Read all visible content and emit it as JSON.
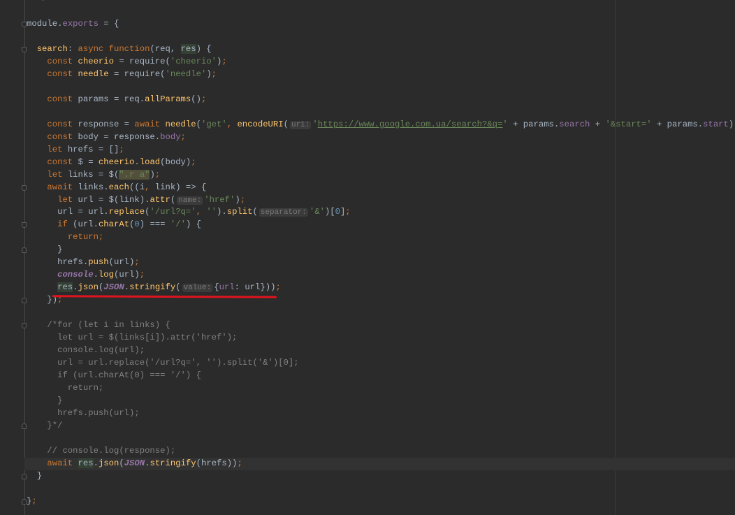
{
  "editor": {
    "theme_colors": {
      "background": "#2b2b2b",
      "keyword": "#cc7832",
      "string": "#6a8759",
      "function": "#ffc66d",
      "property": "#9876aa",
      "annotation": "#e0141e"
    },
    "current_line": 37,
    "lines": [
      [
        [
          "cm",
          "  */"
        ]
      ],
      [],
      [
        [
          "plain",
          "module."
        ],
        [
          "prop",
          "exports"
        ],
        [
          "plain",
          " = {"
        ]
      ],
      [],
      [
        [
          "plain",
          "  "
        ],
        [
          "fn",
          "search"
        ],
        [
          "plain",
          ": "
        ],
        [
          "kw",
          "async function"
        ],
        [
          "plain",
          "(req, "
        ],
        [
          "hl",
          "res"
        ],
        [
          "plain",
          ") {"
        ]
      ],
      [
        [
          "plain",
          "    "
        ],
        [
          "kw",
          "const "
        ],
        [
          "fn",
          "cheerio"
        ],
        [
          "plain",
          " = require("
        ],
        [
          "str",
          "'cheerio'"
        ],
        [
          "plain",
          ")"
        ],
        [
          "kw",
          ";"
        ]
      ],
      [
        [
          "plain",
          "    "
        ],
        [
          "kw",
          "const "
        ],
        [
          "fn",
          "needle"
        ],
        [
          "plain",
          " = require("
        ],
        [
          "str",
          "'needle'"
        ],
        [
          "plain",
          ")"
        ],
        [
          "kw",
          ";"
        ]
      ],
      [],
      [
        [
          "plain",
          "    "
        ],
        [
          "kw",
          "const "
        ],
        [
          "plain",
          "params = req."
        ],
        [
          "fn",
          "allParams"
        ],
        [
          "plain",
          "()"
        ],
        [
          "kw",
          ";"
        ]
      ],
      [],
      [
        [
          "plain",
          "    "
        ],
        [
          "kw",
          "const "
        ],
        [
          "plain",
          "response = "
        ],
        [
          "kw",
          "await "
        ],
        [
          "fn",
          "needle"
        ],
        [
          "plain",
          "("
        ],
        [
          "str",
          "'get'"
        ],
        [
          "kw",
          ", "
        ],
        [
          "fn",
          "encodeURI"
        ],
        [
          "plain",
          "("
        ],
        [
          "hint",
          "uri:"
        ],
        [
          "str",
          "'"
        ],
        [
          "url",
          "https://www.google.com.ua/search?&q="
        ],
        [
          "str",
          "'"
        ],
        [
          "plain",
          " + params."
        ],
        [
          "prop",
          "search"
        ],
        [
          "plain",
          " + "
        ],
        [
          "str",
          "'&start='"
        ],
        [
          "plain",
          " + params."
        ],
        [
          "prop",
          "start"
        ],
        [
          "plain",
          "))"
        ],
        [
          "kw",
          ";"
        ]
      ],
      [
        [
          "plain",
          "    "
        ],
        [
          "kw",
          "const "
        ],
        [
          "plain",
          "body = response."
        ],
        [
          "prop",
          "body"
        ],
        [
          "kw",
          ";"
        ]
      ],
      [
        [
          "plain",
          "    "
        ],
        [
          "kw",
          "let "
        ],
        [
          "plain",
          "hrefs = []"
        ],
        [
          "kw",
          ";"
        ]
      ],
      [
        [
          "plain",
          "    "
        ],
        [
          "kw",
          "const "
        ],
        [
          "plain",
          "$ = "
        ],
        [
          "fn",
          "cheerio"
        ],
        [
          "plain",
          "."
        ],
        [
          "fn",
          "load"
        ],
        [
          "plain",
          "(body)"
        ],
        [
          "kw",
          ";"
        ]
      ],
      [
        [
          "plain",
          "    "
        ],
        [
          "kw",
          "let "
        ],
        [
          "plain",
          "links = $("
        ],
        [
          "sel",
          "\".r a\""
        ],
        [
          "plain",
          ")"
        ],
        [
          "kw",
          ";"
        ]
      ],
      [
        [
          "plain",
          "    "
        ],
        [
          "kw",
          "await "
        ],
        [
          "plain",
          "links."
        ],
        [
          "fn",
          "each"
        ],
        [
          "plain",
          "((i"
        ],
        [
          "kw",
          ", "
        ],
        [
          "plain",
          "link) => {"
        ]
      ],
      [
        [
          "plain",
          "      "
        ],
        [
          "kw",
          "let "
        ],
        [
          "plain",
          "url = $(link)."
        ],
        [
          "fn",
          "attr"
        ],
        [
          "plain",
          "("
        ],
        [
          "hint",
          "name:"
        ],
        [
          "str",
          "'href'"
        ],
        [
          "plain",
          ")"
        ],
        [
          "kw",
          ";"
        ]
      ],
      [
        [
          "plain",
          "      url = url."
        ],
        [
          "fn",
          "replace"
        ],
        [
          "plain",
          "("
        ],
        [
          "str",
          "'/url?q='"
        ],
        [
          "kw",
          ", "
        ],
        [
          "str",
          "''"
        ],
        [
          "plain",
          ")."
        ],
        [
          "fn",
          "split"
        ],
        [
          "plain",
          "("
        ],
        [
          "hint",
          "separator:"
        ],
        [
          "str",
          "'&'"
        ],
        [
          "plain",
          ")["
        ],
        [
          "num",
          "0"
        ],
        [
          "plain",
          "]"
        ],
        [
          "kw",
          ";"
        ]
      ],
      [
        [
          "plain",
          "      "
        ],
        [
          "kw",
          "if "
        ],
        [
          "plain",
          "(url."
        ],
        [
          "fn",
          "charAt"
        ],
        [
          "plain",
          "("
        ],
        [
          "num",
          "0"
        ],
        [
          "plain",
          ") === "
        ],
        [
          "str",
          "'/'"
        ],
        [
          "plain",
          ") {"
        ]
      ],
      [
        [
          "plain",
          "        "
        ],
        [
          "kw",
          "return;"
        ]
      ],
      [
        [
          "plain",
          "      }"
        ]
      ],
      [
        [
          "plain",
          "      hrefs."
        ],
        [
          "fn",
          "push"
        ],
        [
          "plain",
          "(url)"
        ],
        [
          "kw",
          ";"
        ]
      ],
      [
        [
          "plain",
          "      "
        ],
        [
          "glob",
          "console"
        ],
        [
          "plain",
          "."
        ],
        [
          "fn",
          "log"
        ],
        [
          "plain",
          "(url)"
        ],
        [
          "kw",
          ";"
        ]
      ],
      [
        [
          "plain",
          "      "
        ],
        [
          "hl",
          "res"
        ],
        [
          "plain",
          "."
        ],
        [
          "fn",
          "json"
        ],
        [
          "plain",
          "("
        ],
        [
          "glob",
          "JSON"
        ],
        [
          "plain",
          "."
        ],
        [
          "fn",
          "stringify"
        ],
        [
          "plain",
          "("
        ],
        [
          "hint",
          "value:"
        ],
        [
          "plain",
          "{"
        ],
        [
          "prop",
          "url"
        ],
        [
          "plain",
          ": url}))"
        ],
        [
          "kw",
          ";"
        ]
      ],
      [
        [
          "plain",
          "    })"
        ],
        [
          "kw",
          ";"
        ]
      ],
      [],
      [
        [
          "cm",
          "    /*for (let i in links) {"
        ]
      ],
      [
        [
          "cm",
          "      let url = $(links[i]).attr('href');"
        ]
      ],
      [
        [
          "cm",
          "      console.log(url);"
        ]
      ],
      [
        [
          "cm",
          "      url = url.replace('/url?q=', '').split('&')[0];"
        ]
      ],
      [
        [
          "cm",
          "      if (url.charAt(0) === '/') {"
        ]
      ],
      [
        [
          "cm",
          "        return;"
        ]
      ],
      [
        [
          "cm",
          "      }"
        ]
      ],
      [
        [
          "cm",
          "      hrefs.push(url);"
        ]
      ],
      [
        [
          "cm",
          "    }*/"
        ]
      ],
      [],
      [
        [
          "cm",
          "    // console.log(response);"
        ]
      ],
      [
        [
          "plain",
          "    "
        ],
        [
          "kw",
          "await "
        ],
        [
          "hl",
          "res"
        ],
        [
          "plain",
          "."
        ],
        [
          "fn",
          "json"
        ],
        [
          "plain",
          "("
        ],
        [
          "glob",
          "JSON"
        ],
        [
          "plain",
          "."
        ],
        [
          "fn",
          "stringify"
        ],
        [
          "plain",
          "(hrefs))"
        ],
        [
          "kw",
          ";"
        ]
      ],
      [
        [
          "plain",
          "  }"
        ]
      ],
      [],
      [
        [
          "plain",
          "}"
        ],
        [
          "kw",
          ";"
        ]
      ]
    ]
  }
}
